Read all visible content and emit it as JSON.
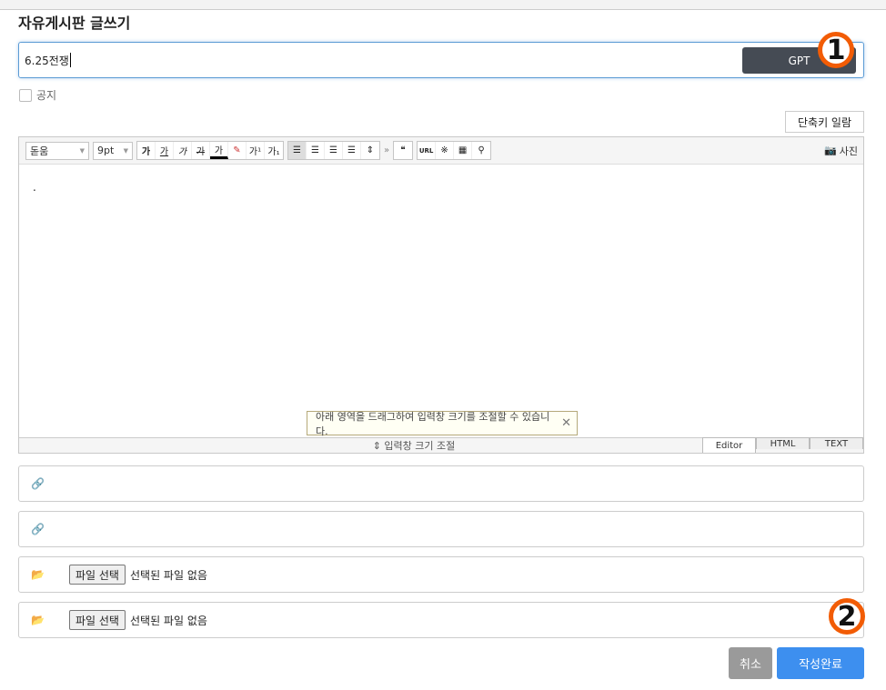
{
  "page": {
    "title": "자유게시판 글쓰기"
  },
  "subject": {
    "value": "6.25전쟁",
    "gpt_label": "GPT"
  },
  "badges": [
    "1",
    "2"
  ],
  "notice": {
    "label": "공지"
  },
  "shortcut_label": "단축키 일람",
  "toolbar": {
    "font": "돋움",
    "size": "9pt",
    "buttons": [
      "가",
      "가",
      "가",
      "가",
      "가",
      "",
      "가¹",
      "가₁"
    ],
    "photo_label": "사진"
  },
  "editor": {
    "content": ".",
    "tip": "아래 영역을 드래그하여 입력창 크기를 조절할 수 있습니다.",
    "resize_label": "⇕ 입력창 크기 조절",
    "modes": [
      "Editor",
      "HTML",
      "TEXT"
    ]
  },
  "files": [
    {
      "button": "파일 선택",
      "status": "선택된 파일 없음"
    },
    {
      "button": "파일 선택",
      "status": "선택된 파일 없음"
    }
  ],
  "actions": {
    "cancel": "취소",
    "submit": "작성완료"
  },
  "colors": {
    "accent": "#3d8fef",
    "gpt": "#454b54",
    "badge": "#f25c05"
  }
}
